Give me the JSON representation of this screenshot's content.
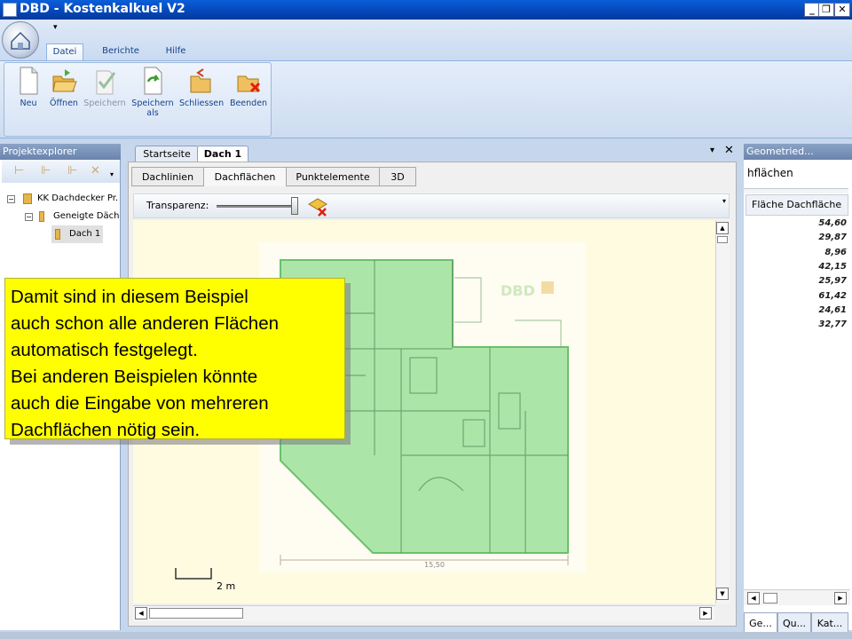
{
  "window": {
    "title": "DBD - Kostenkalkuel V2"
  },
  "ribbon": {
    "tabs": [
      {
        "label": "Datei"
      },
      {
        "label": "Berichte"
      },
      {
        "label": "Hilfe"
      }
    ],
    "buttons": [
      {
        "label": "Neu",
        "icon": "new-document-icon",
        "enabled": true
      },
      {
        "label": "Öffnen",
        "icon": "open-folder-icon",
        "enabled": true
      },
      {
        "label": "Speichern",
        "icon": "save-check-icon",
        "enabled": false
      },
      {
        "label": "Speichern\nals",
        "icon": "save-as-icon",
        "enabled": true
      },
      {
        "label": "Schliessen",
        "icon": "close-folder-icon",
        "enabled": true
      },
      {
        "label": "Beenden",
        "icon": "exit-icon",
        "enabled": true
      }
    ]
  },
  "left_panel": {
    "title": "Projektexplorer",
    "tree": [
      {
        "label": "KK Dachdecker Pr."
      },
      {
        "label": "Geneigte Däch"
      },
      {
        "label": "Dach 1"
      }
    ]
  },
  "document": {
    "tabs": [
      {
        "label": "Startseite"
      },
      {
        "label": "Dach 1"
      }
    ],
    "subtabs": [
      {
        "label": "Dachlinien"
      },
      {
        "label": "Dachflächen"
      },
      {
        "label": "Punktelemente"
      },
      {
        "label": "3D"
      }
    ],
    "transparency_label": "Transparenz:",
    "transparency_level": 1.0,
    "plan": {
      "dimension": "15,50",
      "scale_label": "2 m"
    }
  },
  "right_panel": {
    "title": "Geometried...",
    "field_value": "hflächen",
    "column_header": "Fläche Dachfläche",
    "values": [
      "54,60",
      "29,87",
      "8,96",
      "42,15",
      "25,97",
      "61,42",
      "24,61",
      "32,77"
    ],
    "tabs": [
      {
        "label": "Ge..."
      },
      {
        "label": "Qu..."
      },
      {
        "label": "Kat..."
      }
    ]
  },
  "callout": {
    "lines": [
      "Damit sind in diesem Beispiel",
      "auch schon alle anderen Flächen",
      "automatisch festgelegt.",
      "Bei anderen Beispielen könnte",
      "auch die Eingabe von mehreren",
      "Dachflächen nötig sein."
    ]
  },
  "colors": {
    "callout_bg": "#ffff00",
    "roof_fill": "#8fdd8f",
    "titlebar": "#0446b8"
  }
}
